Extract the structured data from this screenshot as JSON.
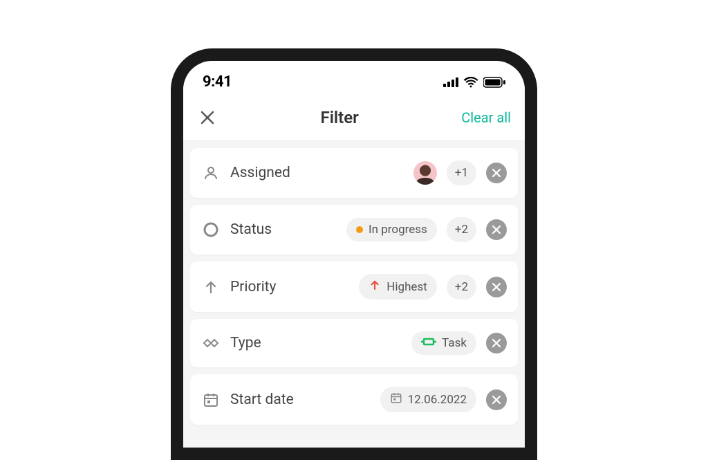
{
  "statusbar": {
    "time": "9:41"
  },
  "header": {
    "title": "Filter",
    "clear_label": "Clear all"
  },
  "filters": {
    "assigned": {
      "label": "Assigned",
      "more_count": "+1"
    },
    "status": {
      "label": "Status",
      "chip_value": "In progress",
      "more_count": "+2",
      "dot_color": "#f39c12"
    },
    "priority": {
      "label": "Priority",
      "chip_value": "Highest",
      "more_count": "+2"
    },
    "type": {
      "label": "Type",
      "chip_value": "Task"
    },
    "start_date": {
      "label": "Start date",
      "chip_value": "12.06.2022"
    }
  }
}
